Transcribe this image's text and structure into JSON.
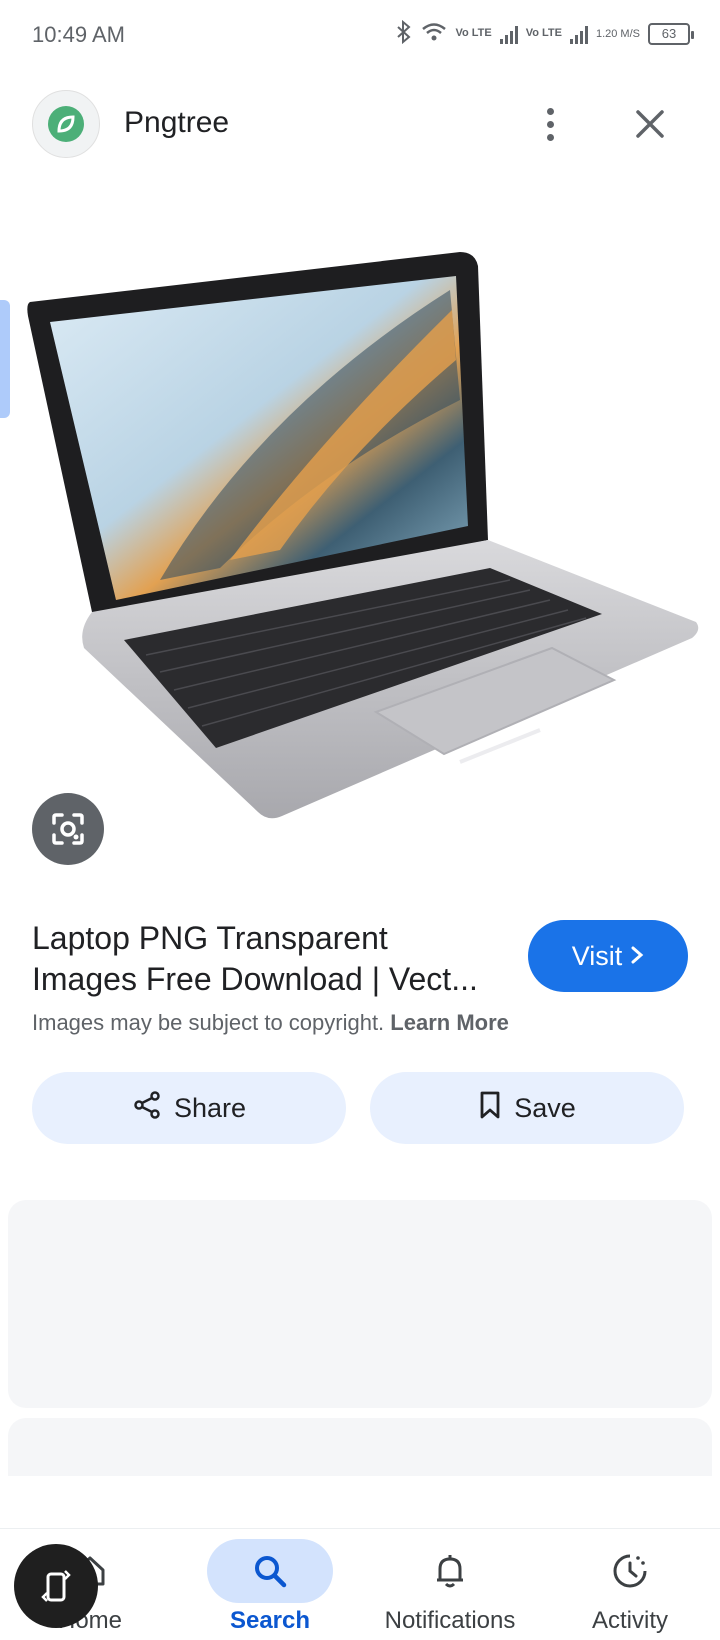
{
  "status_bar": {
    "time": "10:49 AM",
    "volte_1": "Vo LTE",
    "volte_2": "Vo LTE",
    "speed": "1.20 M/S",
    "battery": "63"
  },
  "header": {
    "site_name": "Pngtree"
  },
  "result": {
    "title": "Laptop PNG Transparent Images Free Download | Vect...",
    "visit_label": "Visit",
    "copyright_text": "Images may be subject to copyright.",
    "learn_more": "Learn More"
  },
  "actions": {
    "share_label": "Share",
    "save_label": "Save"
  },
  "bottom_nav": {
    "items": [
      {
        "label": "Home",
        "icon": "home-icon",
        "active": false
      },
      {
        "label": "Search",
        "icon": "search-icon",
        "active": true
      },
      {
        "label": "Notifications",
        "icon": "bell-icon",
        "active": false
      },
      {
        "label": "Activity",
        "icon": "activity-icon",
        "active": false
      }
    ]
  },
  "colors": {
    "accent": "#1a73e8",
    "chip_bg": "#e8f0fe",
    "nav_active_bg": "#d3e3fd",
    "nav_active_text": "#0b57d0"
  }
}
